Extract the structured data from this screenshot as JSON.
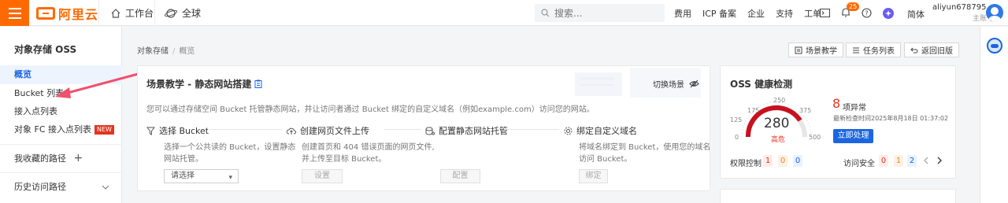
{
  "topbar": {
    "logo_text": "阿里云",
    "workbench_label": "工作台",
    "global_label": "全球",
    "search_placeholder": "搜索...",
    "links": [
      "费用",
      "ICP 备案",
      "企业",
      "支持",
      "工单"
    ],
    "notification_count": "25",
    "language": "简体",
    "username": "aliyun678795...",
    "role": "主账号"
  },
  "sidebar": {
    "title": "对象存储 OSS",
    "items": [
      {
        "label": "概览",
        "active": true
      },
      {
        "label": "Bucket 列表"
      },
      {
        "label": "接入点列表"
      },
      {
        "label": "对象 FC 接入点列表",
        "tag": "NEW"
      }
    ],
    "favorites_label": "我收藏的路径",
    "history_label": "历史访问路径"
  },
  "breadcrumb": {
    "root": "对象存储",
    "separator": "/",
    "current": "概览"
  },
  "toolbar": {
    "scene_teaching": "场景教学",
    "task_list": "任务列表",
    "back_old": "返回旧版"
  },
  "scene_card": {
    "title": "场景教学 - 静态网站搭建",
    "switch_label": "切换场景",
    "description": "您可以通过存储空间 Bucket 托管静态网站，并让访问者通过 Bucket 绑定的自定义域名（例如example.com）访问您的网站。",
    "steps": [
      {
        "title": "选择 Bucket",
        "desc_line1": "选择一个公共读的 Bucket，设置静态",
        "desc_line2": "网站托管。",
        "control": "请选择"
      },
      {
        "title": "创建网页文件上传",
        "desc_line1": "创建首页和 404 错误页面的网页文件,",
        "desc_line2": "并上传至目标 Bucket。",
        "control": "设置"
      },
      {
        "title": "配置静态网站托管",
        "desc_line1": "",
        "desc_line2": "",
        "control": "配置"
      },
      {
        "title": "绑定自定义域名",
        "desc_line1": "将域名绑定到 Bucket，使用您的域名",
        "desc_line2": "访问 Bucket。",
        "control": "绑定"
      }
    ]
  },
  "health_card": {
    "title": "OSS 健康检测",
    "score": "280",
    "score_level": "高危",
    "gauge_ticks": [
      "0",
      "125",
      "250",
      "375",
      "500",
      "175",
      "375"
    ],
    "anomaly_count": "8",
    "anomaly_label": "项异常",
    "last_check": "最新检查时间2025年8月18日 01:37:02",
    "action_label": "立即处理",
    "permission_label": "权限控制",
    "permission_values": [
      "1",
      "0",
      "0"
    ],
    "access_label": "访问安全",
    "access_values": [
      "0",
      "1",
      "2"
    ]
  },
  "colors": {
    "brand": "#ff6a00",
    "primary": "#1a66e0",
    "danger": "#e3351e"
  }
}
